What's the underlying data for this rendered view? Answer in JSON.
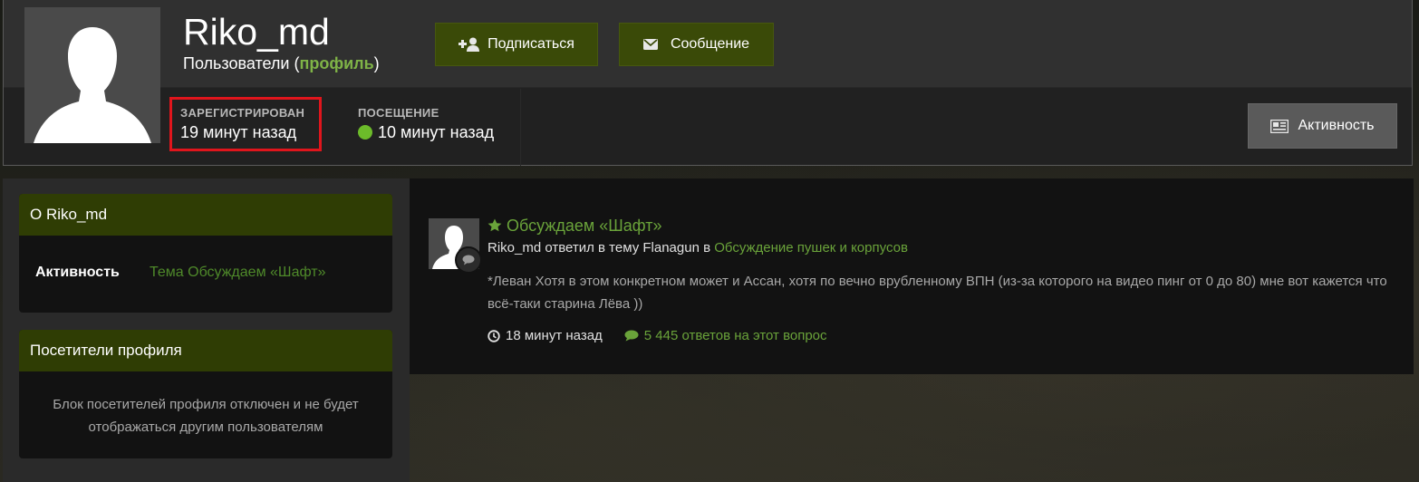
{
  "profile": {
    "username": "Riko_md",
    "group_prefix": "Пользователи (",
    "group_link": "профиль",
    "group_suffix": ")",
    "follow_label": "Подписаться",
    "message_label": "Сообщение",
    "activity_label": "Активность",
    "registered_label": "ЗАРЕГИСТРИРОВАН",
    "registered_value": "19 минут назад",
    "visit_label": "ПОСЕЩЕНИЕ",
    "visit_value": "10 минут назад",
    "online_color": "#6cbb2a"
  },
  "sidebar": {
    "about": {
      "title": "О Riko_md",
      "row_key": "Активность",
      "row_value": "Тема Обсуждаем «Шафт»"
    },
    "visitors": {
      "title": "Посетители профиля",
      "body": "Блок посетителей профиля отключен и не будет отображаться другим пользователям"
    }
  },
  "feed": {
    "item": {
      "title": "Обсуждаем «Шафт»",
      "meta_text": "Riko_md ответил в тему Flanagun в ",
      "meta_link": "Обсуждение пушек и корпусов",
      "excerpt": "*Леван Хотя в этом конкретном может и Ассан, хотя по вечно врубленному ВПН (из-за которого на видео пинг от 0 до 80) мне вот кажется что всё-таки старина Лёва ))",
      "time": "18 минут назад",
      "replies": "5 445 ответов на этот вопрос"
    }
  },
  "colors": {
    "accent_green": "#6aa33a",
    "button_green": "#3a4a08",
    "highlight_red": "#e0151c"
  }
}
